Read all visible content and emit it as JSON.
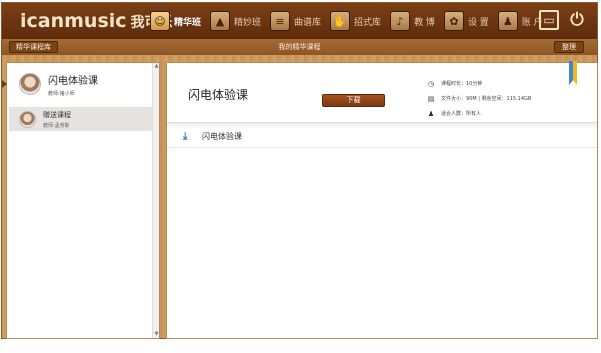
{
  "app": {
    "logo": "icanmusic",
    "logo_cn": "我可乐"
  },
  "nav": [
    {
      "label": "精华班",
      "icon": "graduation-icon",
      "active": true
    },
    {
      "label": "精妙班",
      "icon": "cap-icon",
      "active": false
    },
    {
      "label": "曲谱库",
      "icon": "sheet-icon",
      "active": false
    },
    {
      "label": "招式库",
      "icon": "hand-icon",
      "active": false
    },
    {
      "label": "教 博",
      "icon": "music-note-icon",
      "active": false
    },
    {
      "label": "设 置",
      "icon": "gear-icon",
      "active": false
    },
    {
      "label": "账 户",
      "icon": "user-icon",
      "active": false
    }
  ],
  "subbar": {
    "left_button": "精华课程库",
    "title": "我的精华课程",
    "right_button": "整理"
  },
  "courses": [
    {
      "name": "闪电体验课",
      "teacher": "教师:猪小师"
    },
    {
      "name": "赠送课程",
      "teacher": "教师:孟劳斯"
    }
  ],
  "detail": {
    "title": "闪电体验课",
    "download_label": "下载",
    "duration": "课程时长：10分钟",
    "size": "文件大小：90M | 剩余空间：115.14GB",
    "audience": "适合人群：所有人"
  },
  "files": [
    {
      "name": "闪电体验课"
    }
  ],
  "colors": {
    "topbar": "#6a3410",
    "wood": "#c99559",
    "button": "#7c3a10",
    "accent_blue": "#2f7bbf"
  }
}
